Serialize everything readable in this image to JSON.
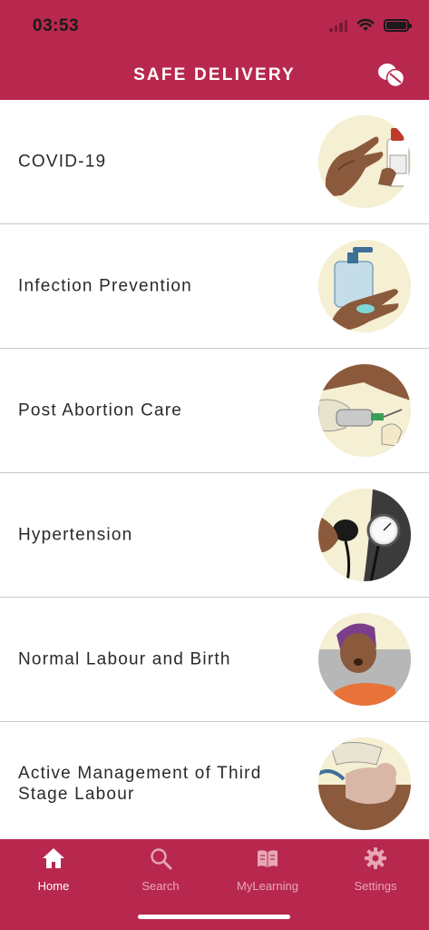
{
  "status_bar": {
    "time": "03:53"
  },
  "header": {
    "title": "SAFE DELIVERY"
  },
  "modules": [
    {
      "label": "COVID-19",
      "icon": "hands-sanitizer-illustration"
    },
    {
      "label": "Infection Prevention",
      "icon": "soap-dispenser-illustration"
    },
    {
      "label": "Post Abortion Care",
      "icon": "syringe-procedure-illustration"
    },
    {
      "label": "Hypertension",
      "icon": "blood-pressure-cuff-illustration"
    },
    {
      "label": "Normal Labour and Birth",
      "icon": "woman-in-labour-illustration"
    },
    {
      "label": "Active Management of Third Stage Labour",
      "icon": "newborn-baby-illustration"
    }
  ],
  "tabbar": {
    "items": [
      {
        "label": "Home",
        "icon": "home-icon",
        "active": true
      },
      {
        "label": "Search",
        "icon": "search-icon",
        "active": false
      },
      {
        "label": "MyLearning",
        "icon": "book-icon",
        "active": false
      },
      {
        "label": "Settings",
        "icon": "gear-icon",
        "active": false
      }
    ]
  },
  "colors": {
    "brand": "#b8284e",
    "tab_inactive": "#e7a6b7",
    "illustration_bg": "#f5efd3"
  }
}
